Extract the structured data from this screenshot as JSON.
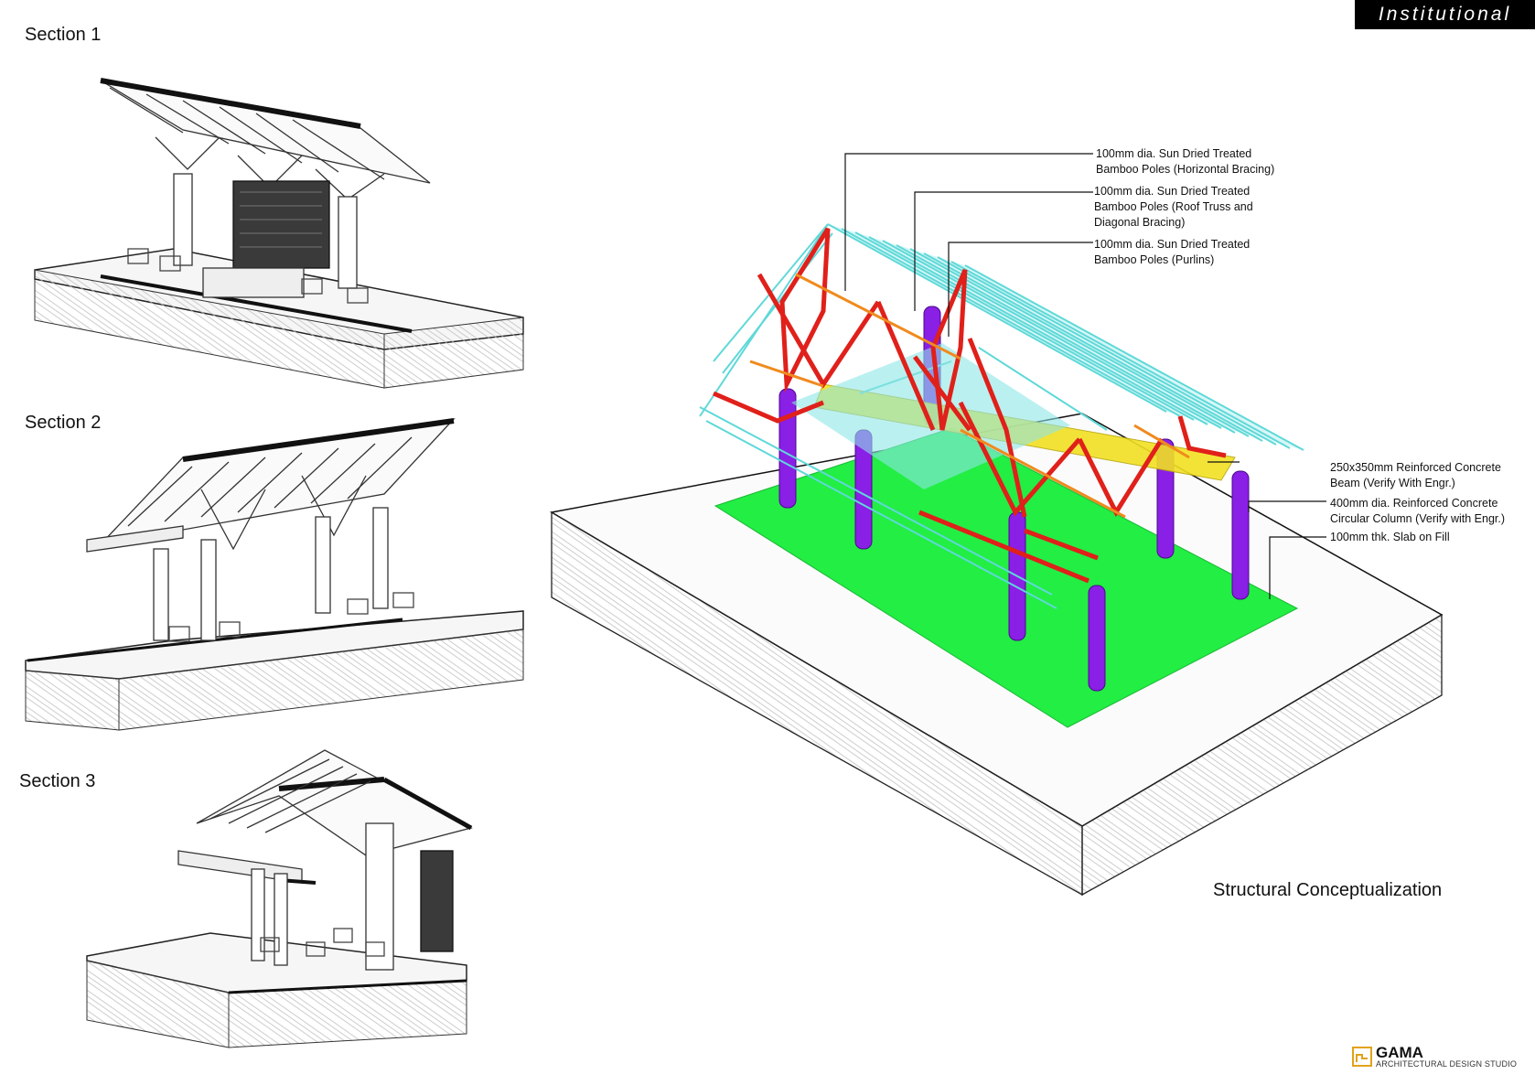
{
  "header": {
    "tag": "Institutional"
  },
  "sections": [
    {
      "label": "Section 1"
    },
    {
      "label": "Section 2"
    },
    {
      "label": "Section 3"
    }
  ],
  "structural": {
    "caption": "Structural Conceptualization",
    "callouts": [
      {
        "text": "100mm dia. Sun Dried Treated\nBamboo Poles (Horizontal Bracing)"
      },
      {
        "text": "100mm dia. Sun Dried Treated\nBamboo Poles (Roof Truss and\nDiagonal Bracing)"
      },
      {
        "text": "100mm dia. Sun Dried Treated\nBamboo Poles (Purlins)"
      },
      {
        "text": "250x350mm Reinforced Concrete\nBeam (Verify With Engr.)"
      },
      {
        "text": "400mm dia. Reinforced Concrete\nCircular Column (Verify with Engr.)"
      },
      {
        "text": "100mm thk. Slab on Fill"
      }
    ]
  },
  "colors": {
    "slab": "#22ee44",
    "column": "#8a1fe6",
    "truss": "#e0201a",
    "purlin": "#5fd8d8",
    "beam": "#f2e022",
    "bracing": "#f08a1e",
    "base": "#ffffff"
  },
  "footer": {
    "logo_name": "GAMA",
    "logo_sub": "ARCHITECTURAL DESIGN STUDIO",
    "logo_icon": "gama-logo-icon"
  }
}
